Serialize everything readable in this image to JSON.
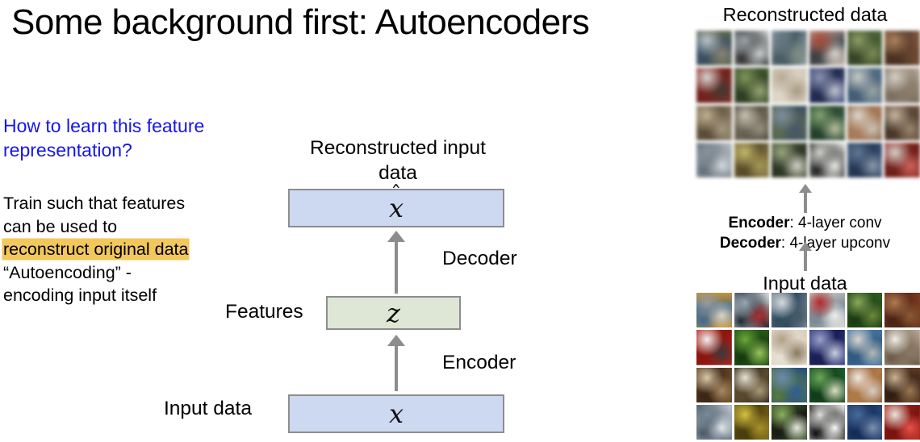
{
  "slide": {
    "title": "Some background first: Autoencoders"
  },
  "left": {
    "question": "How to learn this feature representation?",
    "body_lines": [
      {
        "text": "Train such that features",
        "highlight": false
      },
      {
        "text": "can be used to",
        "highlight": false
      },
      {
        "text": "reconstruct original data",
        "highlight": true
      },
      {
        "text": "“Autoencoding” -",
        "highlight": false
      },
      {
        "text": "encoding input itself",
        "highlight": false
      }
    ]
  },
  "diagram": {
    "reconstructed_label": "Reconstructed input data",
    "xhat_symbol": "x",
    "xhat_hat": "ˆ",
    "decoder_label": "Decoder",
    "features_label": "Features",
    "z_symbol": "z",
    "encoder_label": "Encoder",
    "input_data_label": "Input data",
    "x_symbol": "x",
    "colors": {
      "data_box": "#ccd9f0",
      "feature_box": "#dee7d5",
      "box_border": "#8d8d8d",
      "arrow": "#8d8d8d",
      "highlight": "#f2c75c",
      "question_blue": "#1515ee"
    }
  },
  "right": {
    "reconstructed_caption": "Reconstructed data",
    "input_caption": "Input data",
    "architecture": {
      "encoder_label": "Encoder",
      "encoder_value": ": 4-layer conv",
      "decoder_label": "Decoder",
      "decoder_value": ": 4-layer upconv"
    },
    "reconstructed_grid": {
      "rows": 4,
      "cols": 6,
      "cells": [
        {
          "subject": "ship-on-water",
          "c1": "#5d6a4a",
          "c2": "#bdc4c9",
          "c3": "#2f4f6b",
          "c4": "#8c8470"
        },
        {
          "subject": "boat-white",
          "c1": "#d8dbdc",
          "c2": "#9aa6ad",
          "c3": "#2b2b2b",
          "c4": "#cfd4d6"
        },
        {
          "subject": "boat-harbor",
          "c1": "#9aa7ab",
          "c2": "#5d7584",
          "c3": "#3f5a63",
          "c4": "#7f8d84"
        },
        {
          "subject": "airplane-on-red",
          "c1": "#cfa9a0",
          "c2": "#b8452f",
          "c3": "#3a4147",
          "c4": "#d9d4cc"
        },
        {
          "subject": "frog-green",
          "c1": "#4f6b33",
          "c2": "#8ea05a",
          "c3": "#2f4420",
          "c4": "#7d8f4e"
        },
        {
          "subject": "animal-brown",
          "c1": "#8a5a3a",
          "c2": "#b58155",
          "c3": "#4a2c1c",
          "c4": "#6d4328"
        },
        {
          "subject": "car-on-red",
          "c1": "#a8261c",
          "c2": "#d8d8d4",
          "c3": "#7d2018",
          "c4": "#3d3a38"
        },
        {
          "subject": "frog-leaf",
          "c1": "#3f5d2a",
          "c2": "#7f9a50",
          "c3": "#2a3d1c",
          "c4": "#98a86a"
        },
        {
          "subject": "cat-pale",
          "c1": "#d5c8b4",
          "c2": "#b9a88f",
          "c3": "#e0d8c8",
          "c4": "#a99878"
        },
        {
          "subject": "truck-blue",
          "c1": "#3b4f8a",
          "c2": "#8a92b5",
          "c3": "#1f2c55",
          "c4": "#c3c7da"
        },
        {
          "subject": "dog-on-blue",
          "c1": "#5b7a95",
          "c2": "#c7cbc4",
          "c3": "#3c5d7a",
          "c4": "#9aa8a5"
        },
        {
          "subject": "truck-white",
          "c1": "#b8a894",
          "c2": "#d9d2c6",
          "c3": "#7a6a58",
          "c4": "#8f7f68"
        },
        {
          "subject": "dog-field",
          "c1": "#8a7a5a",
          "c2": "#c3b08a",
          "c3": "#5a4a32",
          "c4": "#a89878"
        },
        {
          "subject": "horse-white",
          "c1": "#3c3426",
          "c2": "#cdc6b4",
          "c3": "#6d6450",
          "c4": "#9a9280"
        },
        {
          "subject": "truck-blue-2",
          "c1": "#2f4a6d",
          "c2": "#7b8fa5",
          "c3": "#5c6f4a",
          "c4": "#44566d"
        },
        {
          "subject": "frog-on-green",
          "c1": "#2f5c3a",
          "c2": "#7da868",
          "c3": "#1f3f28",
          "c4": "#b8c49a"
        },
        {
          "subject": "dog-puppy",
          "c1": "#8a5a3a",
          "c2": "#e2d8cc",
          "c3": "#b07a50",
          "c4": "#cfc4b4"
        },
        {
          "subject": "horse-head",
          "c1": "#6d4f38",
          "c2": "#c9b89a",
          "c3": "#4a3424",
          "c4": "#a08868"
        },
        {
          "subject": "ship-gray",
          "c1": "#b9c2cb",
          "c2": "#8794a1",
          "c3": "#5f6e7a",
          "c4": "#d4dade"
        },
        {
          "subject": "frog-yellow",
          "c1": "#8a7a3a",
          "c2": "#c9b85a",
          "c3": "#5a4a20",
          "c4": "#a89848"
        },
        {
          "subject": "horse-dark",
          "c1": "#4a5a3a",
          "c2": "#9aa878",
          "c3": "#2a3420",
          "c4": "#d8d4c8"
        },
        {
          "subject": "airplane-black",
          "c1": "#eeeeea",
          "c2": "#d8d8d2",
          "c3": "#1a1a1a",
          "c4": "#f2f2ee"
        },
        {
          "subject": "deer-on-blue",
          "c1": "#2f4f7a",
          "c2": "#5b7a9a",
          "c3": "#1f3455",
          "c4": "#8a9ab0"
        },
        {
          "subject": "firetruck-red",
          "c1": "#b02a20",
          "c2": "#d8d4cc",
          "c3": "#7a1c14",
          "c4": "#e2605a"
        }
      ]
    },
    "input_grid": {
      "rows": 4,
      "cols": 6,
      "cells": [
        {
          "subject": "cat-on-person",
          "c1": "#c8922f",
          "c2": "#9a9a9a",
          "c3": "#3f6a95",
          "c4": "#d8d2c4"
        },
        {
          "subject": "boats-white",
          "c1": "#e4e8ea",
          "c2": "#9aa8b4",
          "c3": "#1f2a33",
          "c4": "#b03030"
        },
        {
          "subject": "motorboat",
          "c1": "#7a8a95",
          "c2": "#d4dade",
          "c3": "#2f4a5c",
          "c4": "#44586a"
        },
        {
          "subject": "airplane-poster",
          "c1": "#d8d8d4",
          "c2": "#b02a2a",
          "c3": "#7a8a95",
          "c4": "#eeeeea"
        },
        {
          "subject": "frog-on-grass",
          "c1": "#2f5c20",
          "c2": "#8aa85a",
          "c3": "#1a3a12",
          "c4": "#6d8a3a"
        },
        {
          "subject": "animal-in-dirt",
          "c1": "#7a3a20",
          "c2": "#b07a50",
          "c3": "#4a2214",
          "c4": "#8a5a34"
        },
        {
          "subject": "white-car-red-bg",
          "c1": "#c02018",
          "c2": "#f0f0ee",
          "c3": "#8a1810",
          "c4": "#3a3a3a"
        },
        {
          "subject": "green-frog",
          "c1": "#2a5c1a",
          "c2": "#6aa83a",
          "c3": "#143a0c",
          "c4": "#98c45a"
        },
        {
          "subject": "cat-lying",
          "c1": "#d8cdb8",
          "c2": "#b0a088",
          "c3": "#e8e2d4",
          "c4": "#8a7a60"
        },
        {
          "subject": "blue-truck",
          "c1": "#2f3a8a",
          "c2": "#9aa0c8",
          "c3": "#1a2055",
          "c4": "#c8ccdd"
        },
        {
          "subject": "dog-jumping-blue",
          "c1": "#4a7aa8",
          "c2": "#d8d4cc",
          "c3": "#2f5a80",
          "c4": "#b0b8b4"
        },
        {
          "subject": "delivery-truck",
          "c1": "#b8a894",
          "c2": "#f0eee8",
          "c3": "#6a5a48",
          "c4": "#8a7a64"
        },
        {
          "subject": "dog-sitting",
          "c1": "#6a4a2a",
          "c2": "#d8c8a8",
          "c3": "#3a2414",
          "c4": "#a88a60"
        },
        {
          "subject": "white-horse",
          "c1": "#2a2414",
          "c2": "#e8e2d4",
          "c3": "#5a4a30",
          "c4": "#a89878"
        },
        {
          "subject": "blue-dump-truck",
          "c1": "#1f4a8a",
          "c2": "#6a8ab0",
          "c3": "#5a7a3a",
          "c4": "#2f5c9a"
        },
        {
          "subject": "frog-green-bg",
          "c1": "#1f5c2a",
          "c2": "#6aa858",
          "c3": "#0f3a18",
          "c4": "#d8e0c0"
        },
        {
          "subject": "puppy-brown-white",
          "c1": "#8a5a30",
          "c2": "#f0e8e0",
          "c3": "#b07a48",
          "c4": "#d8ccc0"
        },
        {
          "subject": "horse-bridle",
          "c1": "#5a3a24",
          "c2": "#c8b090",
          "c3": "#2f1c10",
          "c4": "#9a7a54"
        },
        {
          "subject": "ship-docked",
          "c1": "#c4ccd4",
          "c2": "#7a8a98",
          "c3": "#4a5a68",
          "c4": "#e0e6ea"
        },
        {
          "subject": "yellow-frog",
          "c1": "#7a6a1a",
          "c2": "#d4c040",
          "c3": "#4a3c0c",
          "c4": "#a89028"
        },
        {
          "subject": "dark-horse-grass",
          "c1": "#3a5c2a",
          "c2": "#8ab060",
          "c3": "#1a1a14",
          "c4": "#e4e8dc"
        },
        {
          "subject": "airplane-silhouette",
          "c1": "#f2f2f0",
          "c2": "#e0e0dc",
          "c3": "#101010",
          "c4": "#f8f8f6"
        },
        {
          "subject": "deer-blue-bg",
          "c1": "#24467a",
          "c2": "#4a6a98",
          "c3": "#142a55",
          "c4": "#7a90b0"
        },
        {
          "subject": "red-firetruck",
          "c1": "#b82a20",
          "c2": "#e8e4dc",
          "c3": "#7a1410",
          "c4": "#e8504a"
        }
      ]
    }
  }
}
